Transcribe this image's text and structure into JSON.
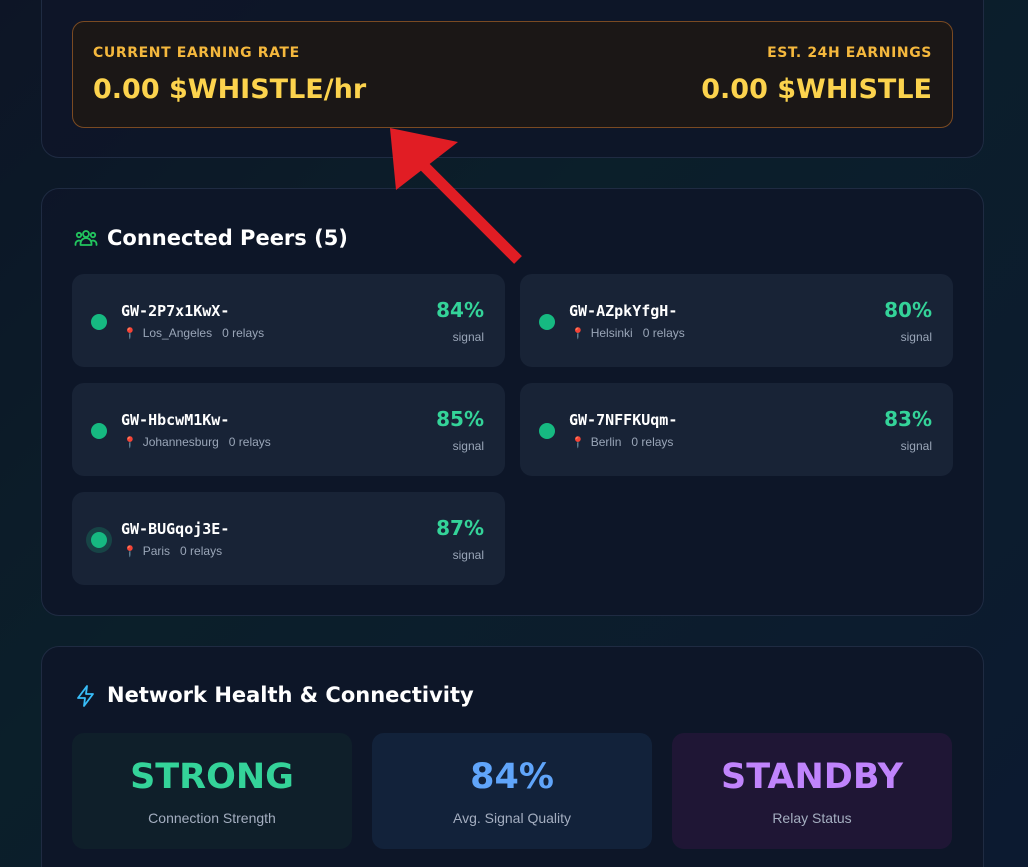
{
  "earnings": {
    "rate_label": "CURRENT EARNING RATE",
    "rate_value": "0.00 $WHISTLE/hr",
    "est_label": "EST. 24H EARNINGS",
    "est_value": "0.00 $WHISTLE"
  },
  "peers": {
    "title": "Connected Peers (5)",
    "icon": "users-icon",
    "items": [
      {
        "id": "GW-2P7x1KwX-",
        "location": "Los_Angeles",
        "relays": "0 relays",
        "signal": "84%",
        "signal_label": "signal"
      },
      {
        "id": "GW-AZpkYfgH-",
        "location": "Helsinki",
        "relays": "0 relays",
        "signal": "80%",
        "signal_label": "signal"
      },
      {
        "id": "GW-HbcwM1Kw-",
        "location": "Johannesburg",
        "relays": "0 relays",
        "signal": "85%",
        "signal_label": "signal"
      },
      {
        "id": "GW-7NFFKUqm-",
        "location": "Berlin",
        "relays": "0 relays",
        "signal": "83%",
        "signal_label": "signal"
      },
      {
        "id": "GW-BUGqoj3E-",
        "location": "Paris",
        "relays": "0 relays",
        "signal": "87%",
        "signal_label": "signal"
      }
    ]
  },
  "health": {
    "title": "Network Health & Connectivity",
    "icon": "lightning-icon",
    "stats": [
      {
        "value": "STRONG",
        "label": "Connection Strength",
        "color": "#34d399"
      },
      {
        "value": "84%",
        "label": "Avg. Signal Quality",
        "color": "#60a5fa"
      },
      {
        "value": "STANDBY",
        "label": "Relay Status",
        "color": "#c084fc"
      }
    ]
  },
  "colors": {
    "accent_gold": "#fcd34d",
    "online_green": "#16b981",
    "annotation_arrow": "#e11d24"
  }
}
